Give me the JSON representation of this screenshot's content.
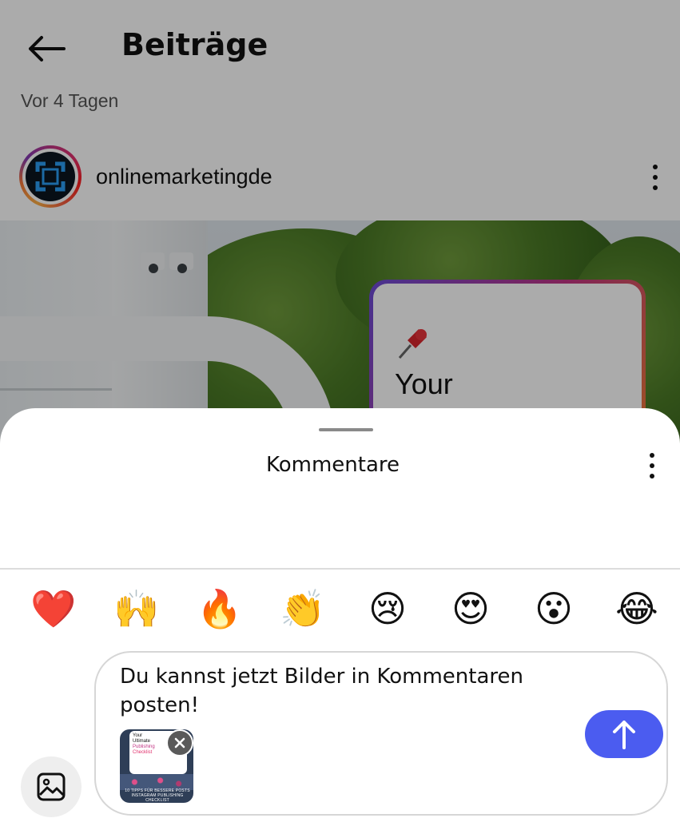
{
  "header": {
    "title": "Beiträge",
    "back_icon": "arrow-left-icon"
  },
  "post": {
    "timestamp": "Vor 4 Tagen",
    "author": "onlinemarketingde",
    "image_card_text": "Your",
    "more_icon": "more-vertical-icon"
  },
  "comments_sheet": {
    "title": "Kommentare",
    "more_icon": "more-vertical-icon",
    "quick_reactions": [
      "❤️",
      "🙌",
      "🔥",
      "👏",
      "😢",
      "😍",
      "😮",
      "😂"
    ],
    "composer": {
      "text": "Du kannst jetzt Bilder in Kommentaren posten!",
      "attachment": {
        "card_lines": [
          "Your",
          "Ultimate",
          "Publishing",
          "Checklist"
        ],
        "caption": "10 TIPPS FÜR BESSERE POSTS INSTAGRAM PUBLISHING CHECKLIST"
      },
      "send_icon": "arrow-up-icon",
      "add_image_icon": "image-icon",
      "remove_icon": "close-icon"
    }
  },
  "colors": {
    "accent": "#4b5cf0",
    "dim_overlay": "rgba(0,0,0,0.33)"
  }
}
